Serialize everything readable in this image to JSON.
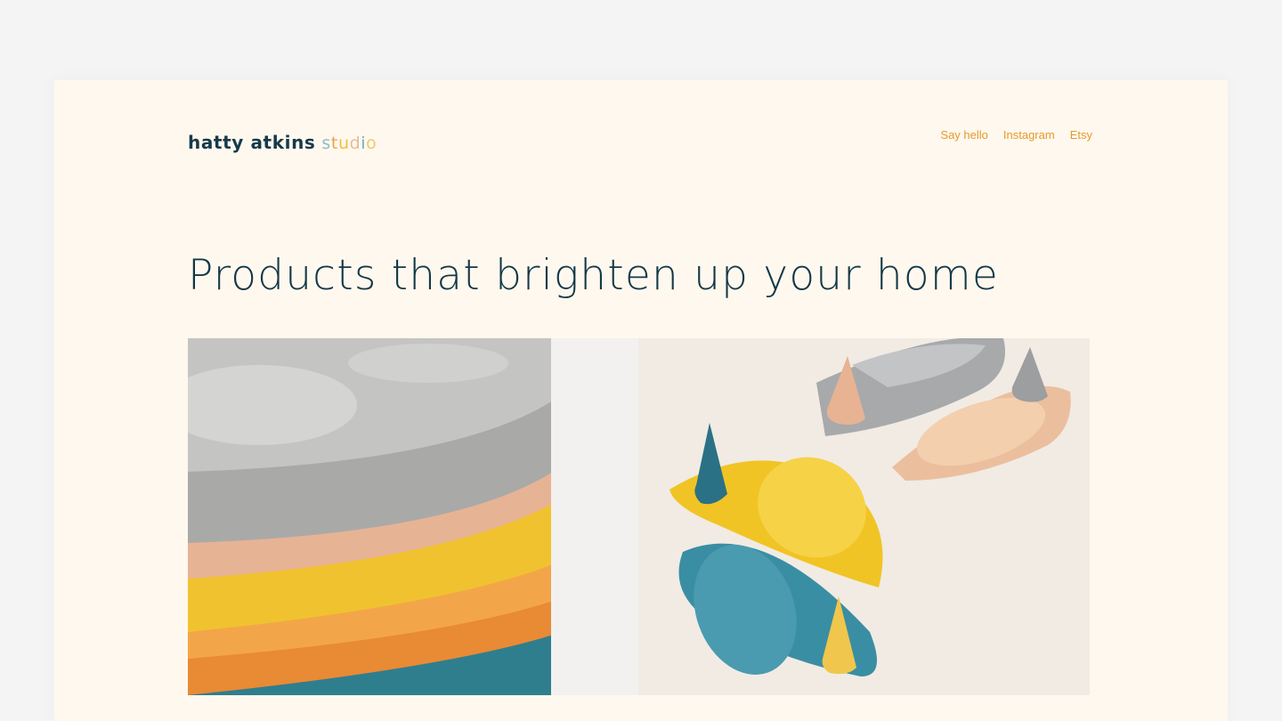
{
  "brand": {
    "name": "hatty atkins",
    "studio_letters": [
      "s",
      "t",
      "u",
      "d",
      "i",
      "o"
    ],
    "studio_colors": [
      "#8bbdc8",
      "#e2a64a",
      "#f0bf3b",
      "#e9b9a0",
      "#6cb2bf",
      "#efc86f"
    ]
  },
  "nav": {
    "items": [
      "Say hello",
      "Instagram",
      "Etsy"
    ],
    "color": "#e69a2a"
  },
  "hero": {
    "headline": "Products that brighten up your home"
  },
  "colors": {
    "background": "#f5f4f5",
    "card": "#fff8ee",
    "text": "#123848"
  }
}
